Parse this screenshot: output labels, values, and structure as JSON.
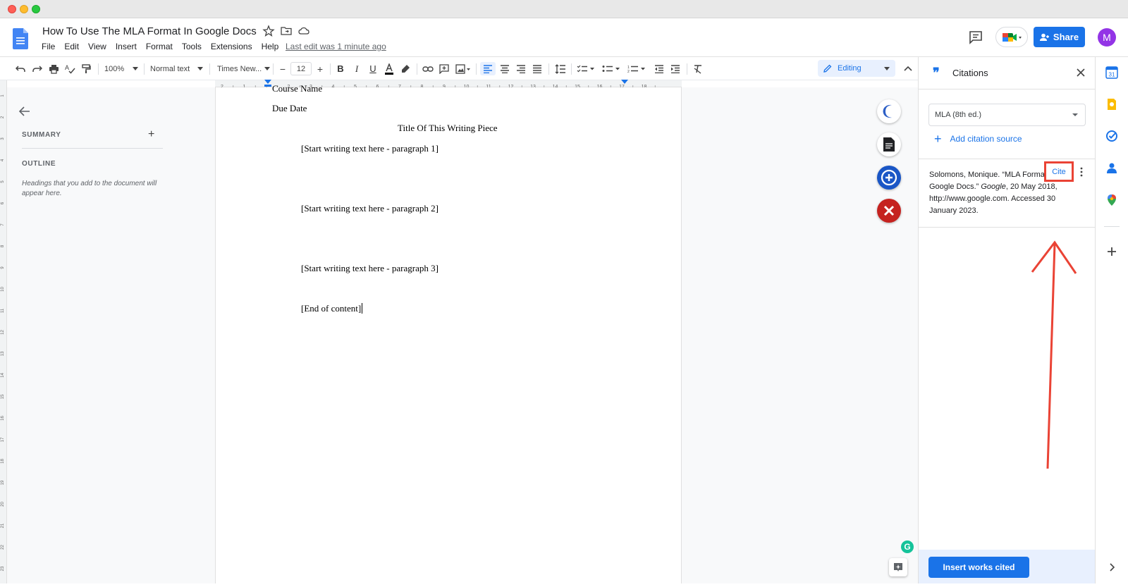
{
  "document": {
    "title": "How To Use The MLA Format In Google Docs",
    "last_edit": "Last edit was 1 minute ago"
  },
  "menu": [
    "File",
    "Edit",
    "View",
    "Insert",
    "Format",
    "Tools",
    "Extensions",
    "Help"
  ],
  "header": {
    "share_label": "Share",
    "avatar_initial": "M"
  },
  "toolbar": {
    "zoom": "100%",
    "style": "Normal text",
    "font": "Times New...",
    "font_size": "12",
    "mode": "Editing"
  },
  "ruler": {
    "ticks": [
      "2",
      "1",
      "1",
      "2",
      "3",
      "4",
      "5",
      "6",
      "7",
      "8",
      "9",
      "10",
      "11",
      "12",
      "13",
      "14",
      "15",
      "16",
      "17",
      "18"
    ]
  },
  "left_ruler": {
    "ticks": [
      "1",
      "2",
      "3",
      "4",
      "5",
      "6",
      "7",
      "8",
      "9",
      "10",
      "11",
      "12",
      "13",
      "14",
      "15",
      "16",
      "17",
      "18",
      "19",
      "20",
      "21",
      "22",
      "23",
      "24"
    ]
  },
  "outline": {
    "summary_label": "SUMMARY",
    "outline_label": "OUTLINE",
    "hint": "Headings that you add to the document will appear here."
  },
  "page": {
    "course": "Course Name",
    "due": "Due Date",
    "heading": "Title Of This Writing Piece",
    "p1": "[Start writing text here - paragraph 1]",
    "p2": "[Start writing text here - paragraph 2]",
    "p3": "[Start writing text here - paragraph 3]",
    "end": "[End of content]"
  },
  "citations_panel": {
    "title": "Citations",
    "style": "MLA (8th ed.)",
    "add_source": "Add citation source",
    "citation_text_pre": "Solomons, Monique. “MLA Format In Google Docs.” ",
    "citation_text_italic": "Google",
    "citation_text_post": ", 20 May 2018, http://www.google.com. Accessed 30 January 2023.",
    "cite_label": "Cite",
    "insert_label": "Insert works cited"
  },
  "colors": {
    "accent": "#1a73e8",
    "highlight_box": "#ea4335",
    "arrow": "#ea4335"
  }
}
